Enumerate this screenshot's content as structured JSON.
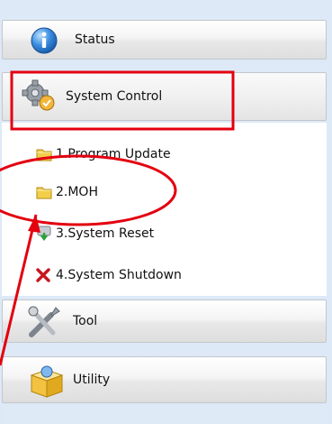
{
  "menu": {
    "status_label": "Status",
    "system_control_label": "System Control",
    "tool_label": "Tool",
    "utility_label": "Utility"
  },
  "system_control_items": [
    {
      "label": "1.Program Update",
      "icon": "folder-icon"
    },
    {
      "label": "2.MOH",
      "icon": "folder-icon"
    },
    {
      "label": "3.System Reset",
      "icon": "reset-icon"
    },
    {
      "label": "4.System Shutdown",
      "icon": "red-x-icon"
    }
  ],
  "colors": {
    "annotation_red": "#e3000f",
    "panel_bg": "#dde9f6",
    "status_icon_blue": "#2d7fd6",
    "folder_yellow": "#f2cf4a"
  }
}
